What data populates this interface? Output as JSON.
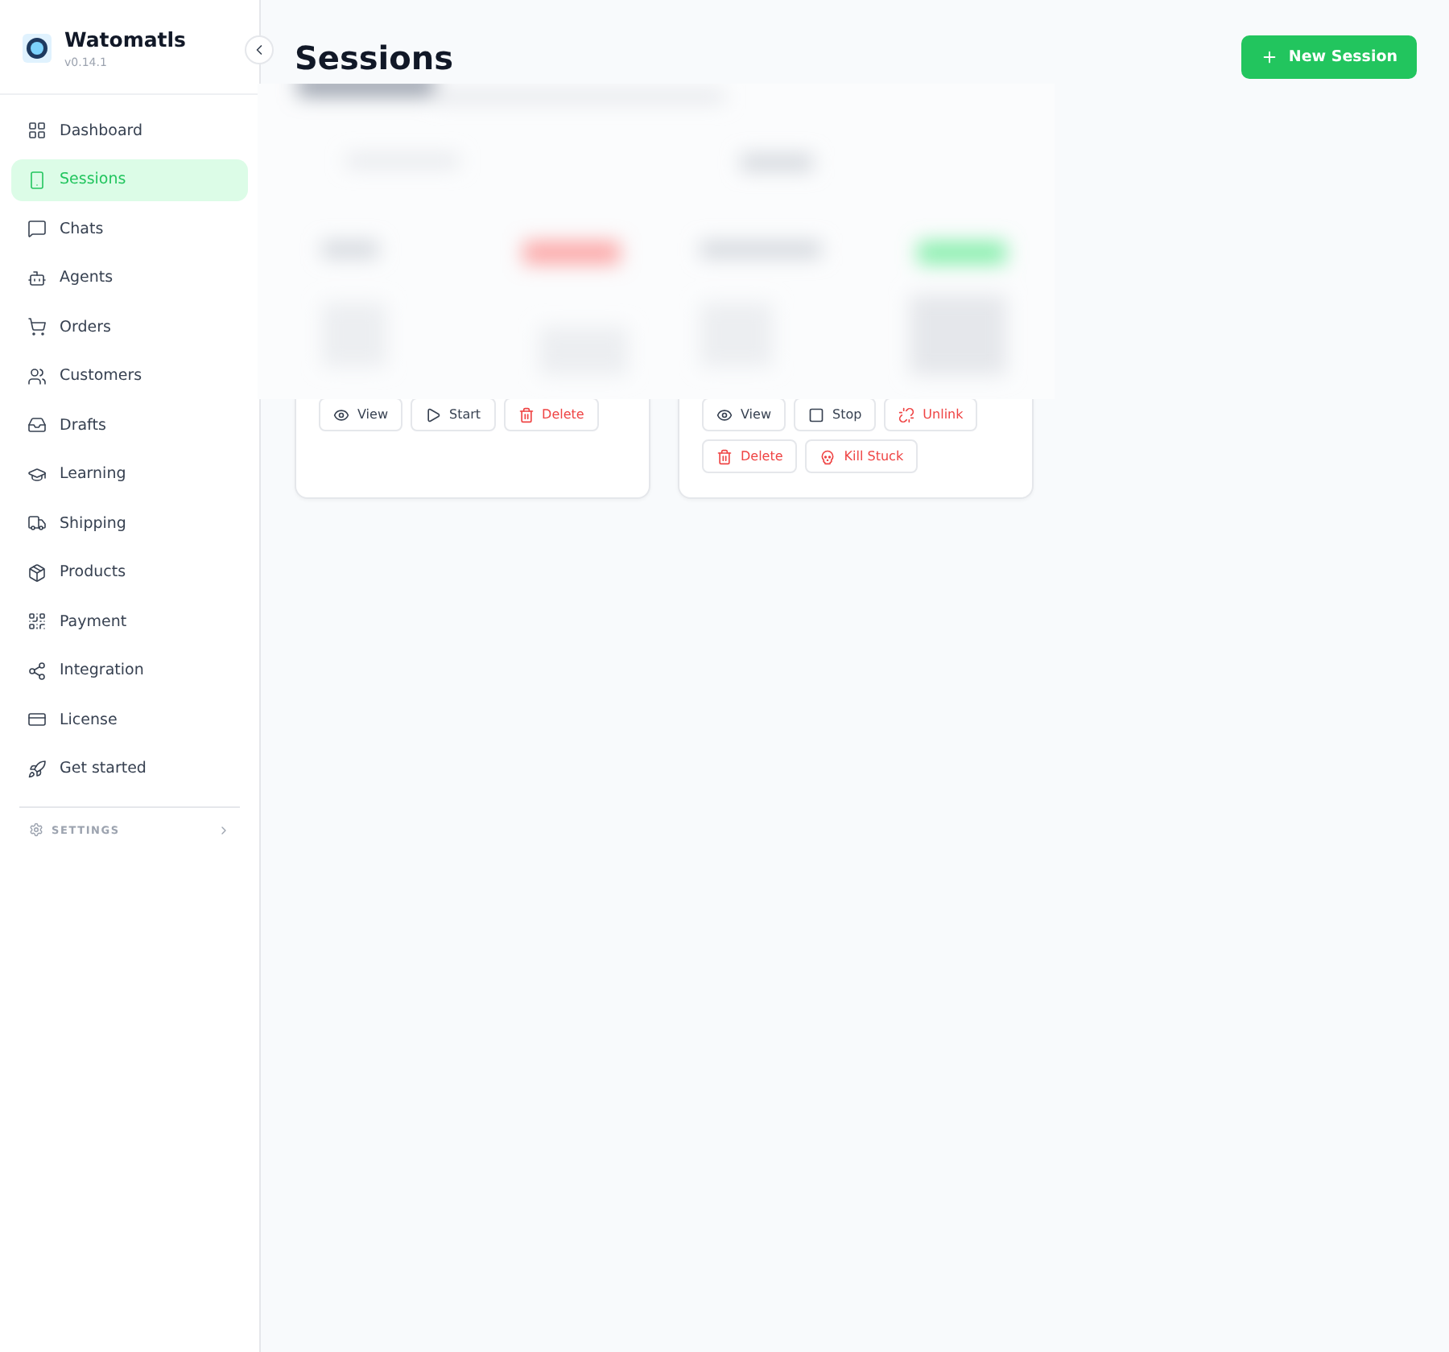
{
  "app": {
    "name": "Watomatls",
    "version": "v0.14.1"
  },
  "nav": [
    {
      "label": "Dashboard",
      "selected": false
    },
    {
      "label": "Sessions",
      "selected": true
    },
    {
      "label": "Chats",
      "selected": false
    },
    {
      "label": "Agents",
      "selected": false
    },
    {
      "label": "Orders",
      "selected": false
    },
    {
      "label": "Customers",
      "selected": false
    },
    {
      "label": "Drafts",
      "selected": false
    },
    {
      "label": "Learning",
      "selected": false
    },
    {
      "label": "Shipping",
      "selected": false
    },
    {
      "label": "Products",
      "selected": false
    },
    {
      "label": "Payment",
      "selected": false
    },
    {
      "label": "Integration",
      "selected": false
    },
    {
      "label": "License",
      "selected": false
    },
    {
      "label": "Get started",
      "selected": false
    }
  ],
  "settings": {
    "label": "SETTINGS"
  },
  "page": {
    "title": "Sessions",
    "new_button": "New Session"
  },
  "cards": [
    {
      "actions": [
        {
          "label": "View",
          "kind": "view"
        },
        {
          "label": "Start",
          "kind": "start"
        },
        {
          "label": "Delete",
          "kind": "delete"
        }
      ]
    },
    {
      "actions": [
        {
          "label": "View",
          "kind": "view"
        },
        {
          "label": "Stop",
          "kind": "stop"
        },
        {
          "label": "Unlink",
          "kind": "unlink"
        },
        {
          "label": "Delete",
          "kind": "delete"
        },
        {
          "label": "Kill Stuck",
          "kind": "kill"
        }
      ]
    }
  ]
}
